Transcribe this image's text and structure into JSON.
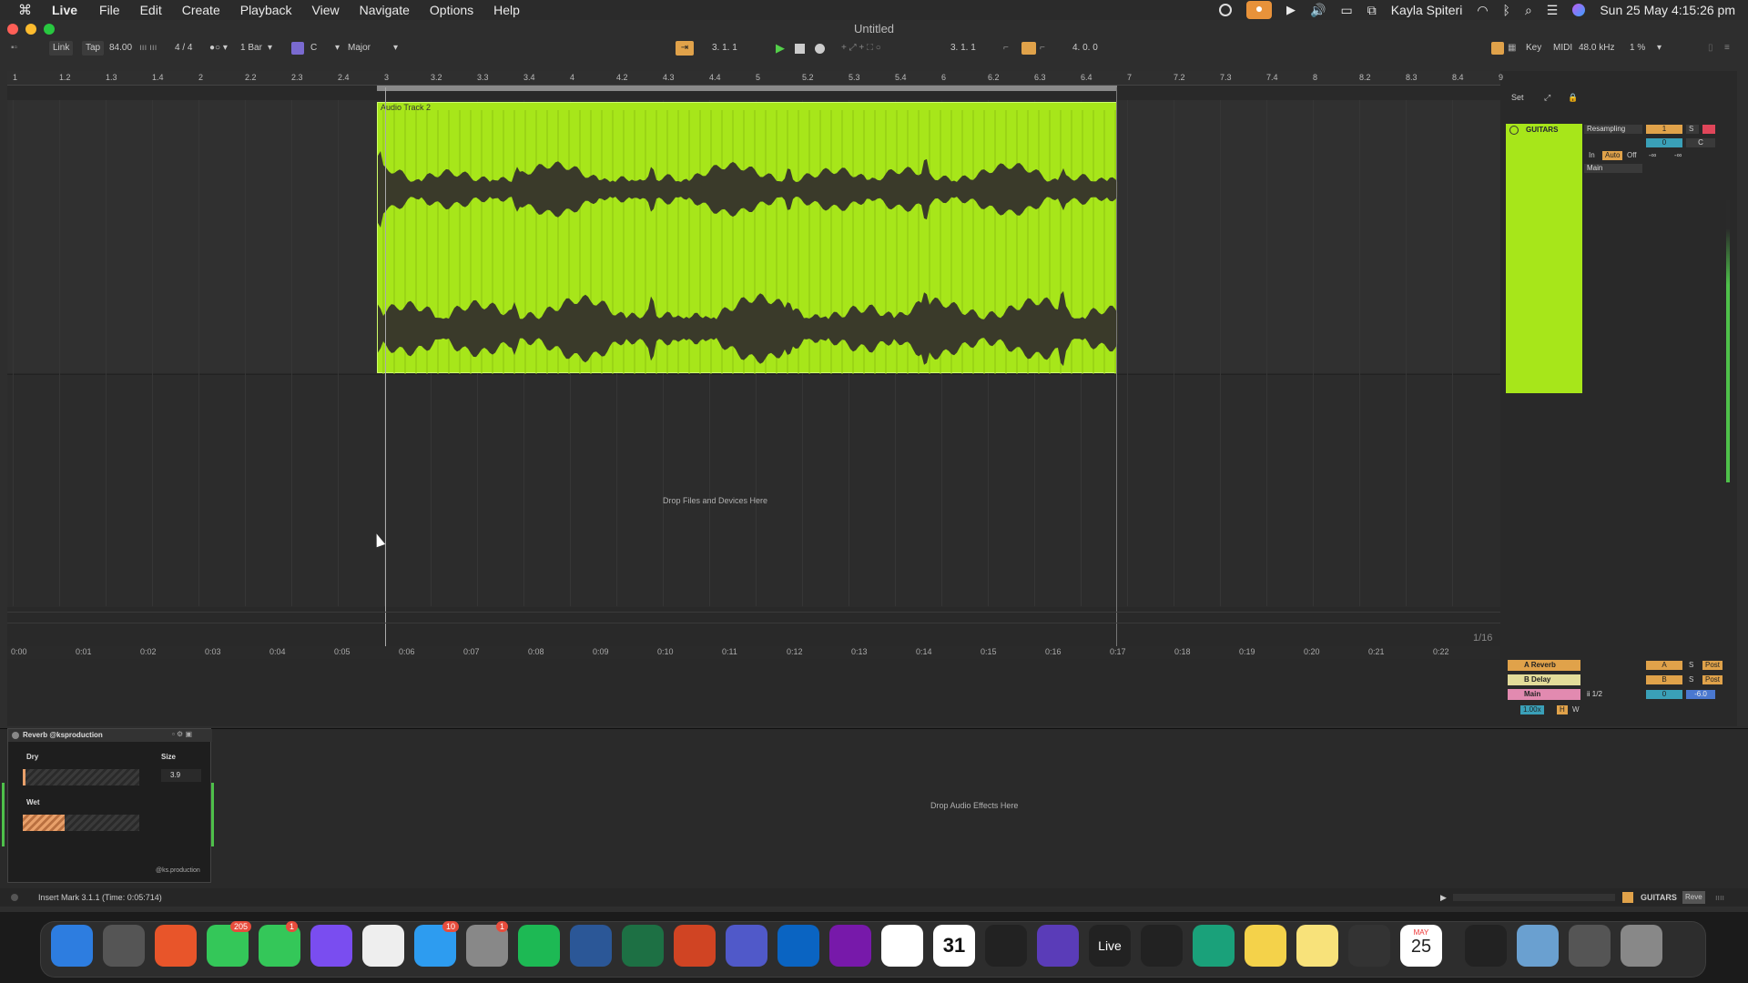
{
  "menubar": {
    "app_name": "Live",
    "items": [
      "File",
      "Edit",
      "Create",
      "Playback",
      "View",
      "Navigate",
      "Options",
      "Help"
    ],
    "user": "Kayla Spiteri",
    "datetime": "Sun 25 May  4:15:26 pm"
  },
  "window": {
    "title": "Untitled"
  },
  "control_bar": {
    "link": "Link",
    "tap": "Tap",
    "tempo": "84.00",
    "time_sig": "4 / 4",
    "quantize": "1 Bar",
    "key": "C",
    "scale": "Major",
    "position": "3.   1.   1",
    "loop_start": "3.   1.   1",
    "loop_length": "4.   0.   0",
    "key_btn": "Key",
    "midi_btn": "MIDI",
    "sample_rate": "48.0 kHz",
    "cpu": "1 %"
  },
  "ruler": {
    "bars": [
      "1",
      "1.2",
      "1.3",
      "1.4",
      "2",
      "2.2",
      "2.3",
      "2.4",
      "3",
      "3.2",
      "3.3",
      "3.4",
      "4",
      "4.2",
      "4.3",
      "4.4",
      "5",
      "5.2",
      "5.3",
      "5.4",
      "6",
      "6.2",
      "6.3",
      "6.4",
      "7",
      "7.2",
      "7.3",
      "7.4",
      "8",
      "8.2",
      "8.3",
      "8.4",
      "9"
    ],
    "times": [
      "0:00",
      "0:01",
      "0:02",
      "0:03",
      "0:04",
      "0:05",
      "0:06",
      "0:07",
      "0:08",
      "0:09",
      "0:10",
      "0:11",
      "0:12",
      "0:13",
      "0:14",
      "0:15",
      "0:16",
      "0:17",
      "0:18",
      "0:19",
      "0:20",
      "0:21",
      "0:22"
    ],
    "set_label": "Set"
  },
  "clip": {
    "name": "Audio Track 2"
  },
  "arrangement": {
    "drop_text": "Drop Files and Devices Here",
    "grid": "1/16"
  },
  "mixer": {
    "track_name": "GUITARS",
    "input_type": "Resampling",
    "track_number": "1",
    "solo": "S",
    "pan": "C",
    "volume": "0",
    "in": "In",
    "auto": "Auto",
    "off": "Off",
    "inf1": "-∞",
    "inf2": "-∞",
    "output": "Main",
    "returns": [
      {
        "name": "A Reverb",
        "letter": "A",
        "solo": "S",
        "post": "Post",
        "color": "#e0a24a"
      },
      {
        "name": "B Delay",
        "letter": "B",
        "solo": "S",
        "post": "Post",
        "color": "#e3dc9a"
      },
      {
        "name": "Main",
        "letter": "0",
        "solo": "",
        "post": "-6.0",
        "color": "#e28ab0"
      }
    ],
    "main_out": "ii 1/2",
    "zoom": "1.00x",
    "h": "H",
    "w": "W"
  },
  "device": {
    "title": "Reverb @ksproduction",
    "dry_label": "Dry",
    "size_label": "Size",
    "size_value": "3.9",
    "wet_label": "Wet",
    "credit": "@ks.production",
    "drop_fx": "Drop Audio Effects Here",
    "dry_level": 0.02,
    "wet_level": 0.36
  },
  "status": {
    "message": "Insert Mark 3.1.1 (Time: 0:05:714)",
    "track": "GUITARS",
    "device_tab": "Reve"
  },
  "dock": {
    "badges": {
      "messages": "205",
      "facetime": "1",
      "appstore": "10",
      "settings": "1"
    },
    "live_label": "Live",
    "calendar_month": "MAY",
    "calendar_day": "25",
    "calendar31": "31"
  }
}
